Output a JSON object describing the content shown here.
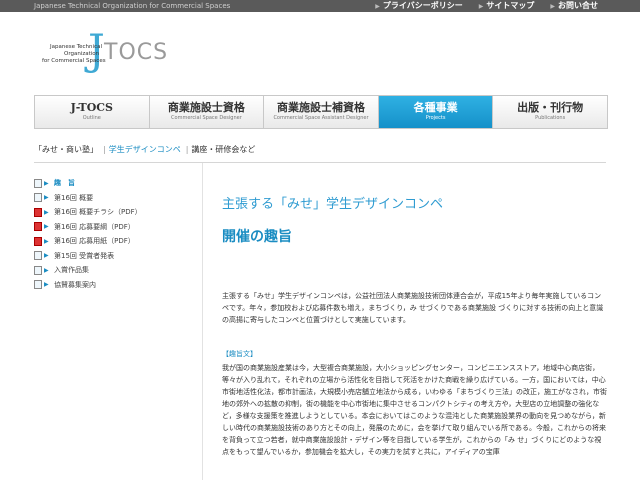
{
  "topbar": {
    "tagline": "Japanese Technical Organization for Commercial Spaces",
    "links": [
      "プライバシーポリシー",
      "サイトマップ",
      "お問い合せ"
    ]
  },
  "logo": {
    "mark": "J",
    "tocs": "TOCS",
    "line1": "Japanese Technical",
    "line2": "Organization",
    "line3": "for Commercial Spaces"
  },
  "nav": [
    {
      "title": "J-TOCS",
      "sub": "Outline",
      "active": false
    },
    {
      "title": "商業施設士資格",
      "sub": "Commercial Space Designer",
      "active": false
    },
    {
      "title": "商業施設士補資格",
      "sub": "Commercial Space Assistant Designer",
      "active": false
    },
    {
      "title": "各種事業",
      "sub": "Projects",
      "active": true
    },
    {
      "title": "出版・刊行物",
      "sub": "Publications",
      "active": false
    }
  ],
  "subnav": {
    "item1": "「みせ・商い塾」",
    "item2": "学生デザインコンペ",
    "item3": "講座・研修会など"
  },
  "sidebar": [
    {
      "label": "趣　旨",
      "icon": "page-icon",
      "top": true
    },
    {
      "label": "第16回 概要",
      "icon": "page-icon"
    },
    {
      "label": "第16回 概要チラシ（PDF）",
      "icon": "pdf-icon"
    },
    {
      "label": "第16回 応募要綱（PDF）",
      "icon": "pdf-icon"
    },
    {
      "label": "第16回 応募用紙（PDF）",
      "icon": "pdf-icon"
    },
    {
      "label": "第15回 受賞者発表",
      "icon": "page-icon"
    },
    {
      "label": "入賞作品集",
      "icon": "page-icon"
    },
    {
      "label": "協賛募集案内",
      "icon": "page-icon"
    }
  ],
  "main": {
    "heading": "主張する「みせ」学生デザインコンペ",
    "subheading": "開催の趣旨",
    "intro": "主張する「みせ」学生デザインコンペは，公益社団法人商業施設技術団体連合会が，平成15年より毎年実施しているコンペです。年々，参加校および応募件数も増え，まちづくり，み せづくりである商業施設 づくりに対する技術の向上と意識の高揚に寄与したコンペと位置づけとして実施しています。",
    "section_label": "【趣旨文】",
    "body": "我が国の商業施設産業は今，大型複合商業施設，大小ショッピングセンター，コンビニエンスストア，地域中心商店街，等々が入り乱れて，それぞれの立場から活性化を目指して死活をかけた商戦を繰り広げている。一方，国においては，中心市街地活性化法，都市計画法，大規模小売店舗立地法から成る，いわゆる「まちづくり三法」の改正，施工がなされ，市街地の郊外への拡散の抑制，街の機能を中心市街地に集中させるコンパクトシティの考え方や，大型店の立地調整の強化など，多様な支援策を推進しようとしている。本会においてはこのような混沌とした商業施設業界の動向を見つめながら，新しい時代の商業施設技術のあり方とその向上，発展のために，会を挙げて取り組んでいる所である。今般，これからの将来を背負って立つ若者，就中商業施設設計・デザイン等を目指している学生が，これからの「み せ」づくりにどのような視点をもって望んでいるか，参加機会を拡大し，その実力を試すと共に，アイディアの宝庫"
  },
  "colors": {
    "accent": "#1a8cc2",
    "nav_active": "#1591c9"
  }
}
